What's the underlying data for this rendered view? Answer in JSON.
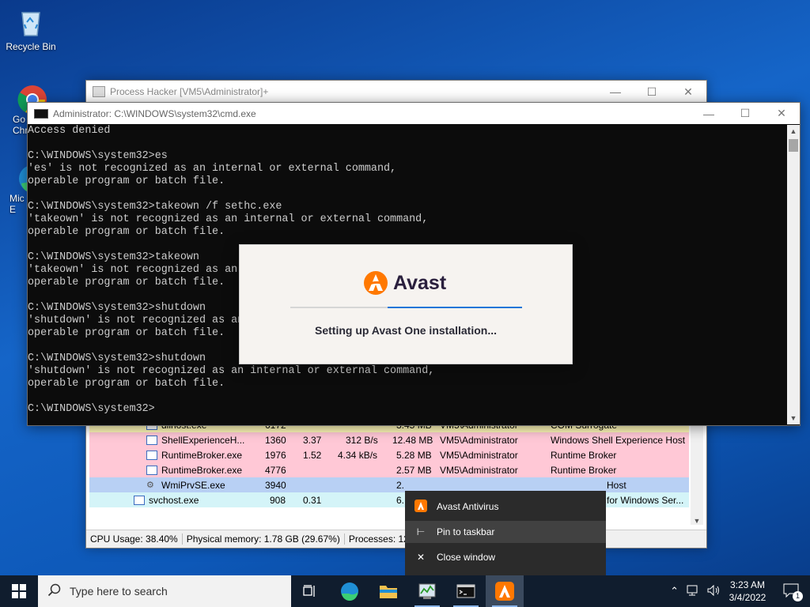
{
  "desktop": {
    "icons": [
      {
        "label": "Recycle Bin"
      },
      {
        "label": "Go\nChr"
      },
      {
        "label": "Mic\nE"
      }
    ]
  },
  "process_hacker": {
    "title": "Process Hacker [VM5\\Administrator]+",
    "rows": [
      {
        "name": "dllhost.exe",
        "pid": "6172",
        "cpu": "",
        "io": "",
        "mem": "3.45 MB",
        "user": "VM5\\Administrator",
        "desc": "COM Surrogate",
        "color": "#fff8b8"
      },
      {
        "name": "ShellExperienceH...",
        "pid": "1360",
        "cpu": "3.37",
        "io": "312 B/s",
        "mem": "12.48 MB",
        "user": "VM5\\Administrator",
        "desc": "Windows Shell Experience Host",
        "color": "#ffc8d6"
      },
      {
        "name": "RuntimeBroker.exe",
        "pid": "1976",
        "cpu": "1.52",
        "io": "4.34 kB/s",
        "mem": "5.28 MB",
        "user": "VM5\\Administrator",
        "desc": "Runtime Broker",
        "color": "#ffc8d6"
      },
      {
        "name": "RuntimeBroker.exe",
        "pid": "4776",
        "cpu": "",
        "io": "",
        "mem": "2.57 MB",
        "user": "VM5\\Administrator",
        "desc": "Runtime Broker",
        "color": "#ffc8d6"
      },
      {
        "name": "WmiPrvSE.exe",
        "pid": "3940",
        "cpu": "",
        "io": "",
        "mem": "2.",
        "user": "",
        "desc": "Host",
        "color": "#b8d0f4"
      },
      {
        "name": "svchost.exe",
        "pid": "908",
        "cpu": "0.31",
        "io": "",
        "mem": "6.",
        "user": "",
        "desc": "for Windows Ser...",
        "color": "#d4f4f8"
      }
    ],
    "status": {
      "cpu": "CPU Usage: 38.40%",
      "memory": "Physical memory: 1.78 GB (29.67%)",
      "processes": "Processes: 121"
    }
  },
  "cmd": {
    "title": "Administrator: C:\\WINDOWS\\system32\\cmd.exe",
    "output": "Access denied\n\nC:\\WINDOWS\\system32>es\n'es' is not recognized as an internal or external command,\noperable program or batch file.\n\nC:\\WINDOWS\\system32>takeown /f sethc.exe\n'takeown' is not recognized as an internal or external command,\noperable program or batch file.\n\nC:\\WINDOWS\\system32>takeown\n'takeown' is not recognized as an internal or external command,\noperable program or batch file.\n\nC:\\WINDOWS\\system32>shutdown\n'shutdown' is not recognized as an internal or external command,\noperable program or batch file.\n\nC:\\WINDOWS\\system32>shutdown\n'shutdown' is not recognized as an internal or external command,\noperable program or batch file.\n\nC:\\WINDOWS\\system32>"
  },
  "avast": {
    "brand": "Avast",
    "message": "Setting up Avast One installation...",
    "progress": 0.58,
    "accent": "#ff7800"
  },
  "jumplist": {
    "items": [
      {
        "label": "Avast Antivirus",
        "icon": "avast-icon"
      },
      {
        "label": "Pin to taskbar",
        "icon": "pin-icon"
      },
      {
        "label": "Close window",
        "icon": "close-icon"
      }
    ]
  },
  "taskbar": {
    "search_placeholder": "Type here to search",
    "time": "3:23 AM",
    "date": "3/4/2022",
    "notification_count": "1"
  }
}
